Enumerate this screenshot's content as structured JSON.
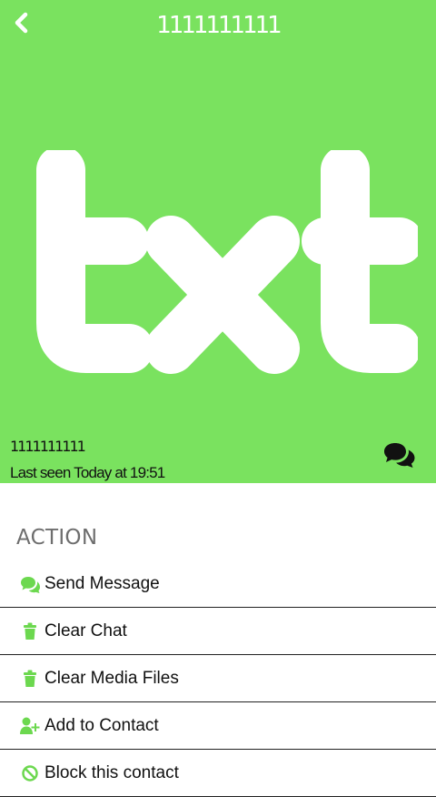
{
  "nav": {
    "title": "1111111111",
    "back_icon": "chevron-left-icon"
  },
  "profile": {
    "logo_text": "txt",
    "number": "1111111111",
    "last_seen": "Last seen Today at 19:51",
    "chat_icon": "chat-bubbles-icon"
  },
  "actions": {
    "section_title": "ACTION",
    "items": [
      {
        "label": "Send Message",
        "icon": "chat-bubble-icon"
      },
      {
        "label": "Clear Chat",
        "icon": "trash-icon"
      },
      {
        "label": "Clear Media Files",
        "icon": "trash-icon"
      },
      {
        "label": "Add to Contact",
        "icon": "add-contact-icon"
      },
      {
        "label": "Block this contact",
        "icon": "block-icon"
      }
    ]
  },
  "colors": {
    "header_bg": "#7ae25f",
    "accent": "#6cd84f",
    "text": "#111111",
    "section_title": "#6e6e6e"
  }
}
